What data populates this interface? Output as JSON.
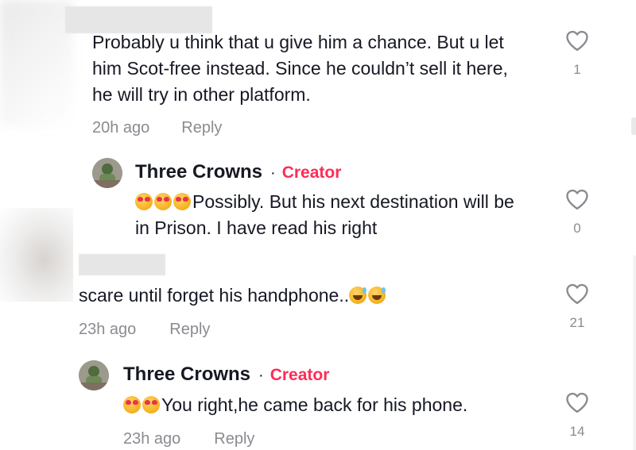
{
  "comments": [
    {
      "text_lines": [
        "Probably u think that u give him a chance. But u let",
        "him Scot-free instead. Since he couldn’t sell it here,",
        "he will try in other platform."
      ],
      "time": "20h ago",
      "reply_label": "Reply",
      "likes": "1"
    },
    {
      "author": "Three Crowns",
      "tag": "Creator",
      "separator": "·",
      "emoji": [
        "love-face-emoji",
        "love-face-emoji",
        "love-face-emoji"
      ],
      "text_lines": [
        "Possibly. But his next destination will be",
        "in Prison. I have read his right"
      ],
      "likes": "0"
    },
    {
      "text": "scare until forget his handphone..",
      "emoji": [
        "sweat-smile-emoji",
        "sweat-smile-emoji"
      ],
      "time": "23h ago",
      "reply_label": "Reply",
      "likes": "21"
    },
    {
      "author": "Three Crowns",
      "tag": "Creator",
      "separator": "·",
      "emoji": [
        "love-face-emoji",
        "love-face-emoji"
      ],
      "text": "You right,he came back for his phone.",
      "time": "23h ago",
      "reply_label": "Reply",
      "likes": "14"
    }
  ],
  "colors": {
    "creator_tag": "#fe2c55",
    "meta_text": "#8a8b91",
    "primary_text": "#161823"
  },
  "icons": [
    "heart-outline-icon"
  ]
}
